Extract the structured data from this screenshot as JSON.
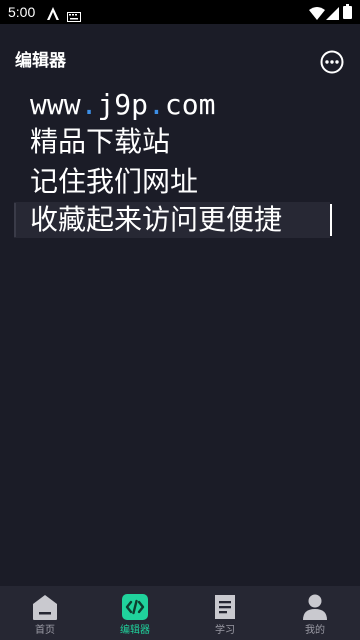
{
  "status_bar": {
    "time": "5:00",
    "icons": [
      "a11y-icon",
      "keyboard-icon",
      "wifi-icon",
      "signal-icon",
      "battery-icon"
    ]
  },
  "app_bar": {
    "title": "编辑器",
    "more_icon": "more-horizontal-icon"
  },
  "editor": {
    "lines": [
      {
        "parts": [
          "www",
          ".",
          "j9p",
          ".",
          "com"
        ]
      },
      {
        "text": "精品下载站"
      },
      {
        "text": "记住我们网址"
      },
      {
        "text": "收藏起来访问更便捷"
      }
    ]
  },
  "bottom_nav": {
    "items": [
      {
        "label": "首页",
        "icon": "home-icon",
        "active": false
      },
      {
        "label": "编辑器",
        "icon": "code-icon",
        "active": true
      },
      {
        "label": "学习",
        "icon": "document-icon",
        "active": false
      },
      {
        "label": "我的",
        "icon": "person-icon",
        "active": false
      }
    ]
  },
  "colors": {
    "background": "#1b1c27",
    "accent": "#20d29c",
    "link_dot": "#3d8fe6",
    "nav_bg": "#262733"
  }
}
